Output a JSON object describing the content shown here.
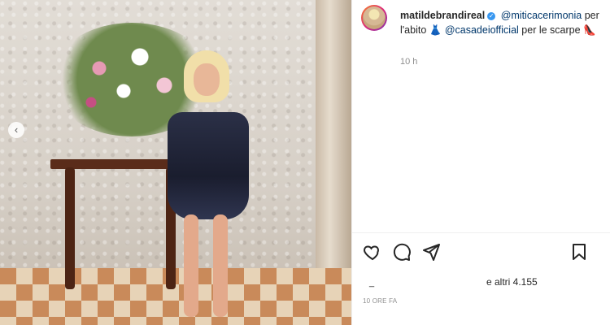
{
  "post": {
    "username": "matildebrandireal",
    "mention_1": "@miticacerimonia",
    "caption_text_1": "per l'abito",
    "emoji_1": "👗",
    "mention_2": "@casadeiofficial",
    "caption_text_2": "per le scarpe",
    "emoji_2": "👠",
    "relative_time": "10 h",
    "likes_text": "e altri 4.155",
    "likes_prefix": "_",
    "timestamp": "10 ORE FA"
  },
  "icons": {
    "like": "heart-icon",
    "comment": "comment-icon",
    "share": "send-icon",
    "save": "bookmark-icon",
    "carousel_prev": "chevron-left-icon",
    "verified": "verified-badge-icon"
  },
  "colors": {
    "mention": "#00376b",
    "verified": "#3897f0",
    "muted": "#8e8e8e",
    "text": "#262626"
  }
}
